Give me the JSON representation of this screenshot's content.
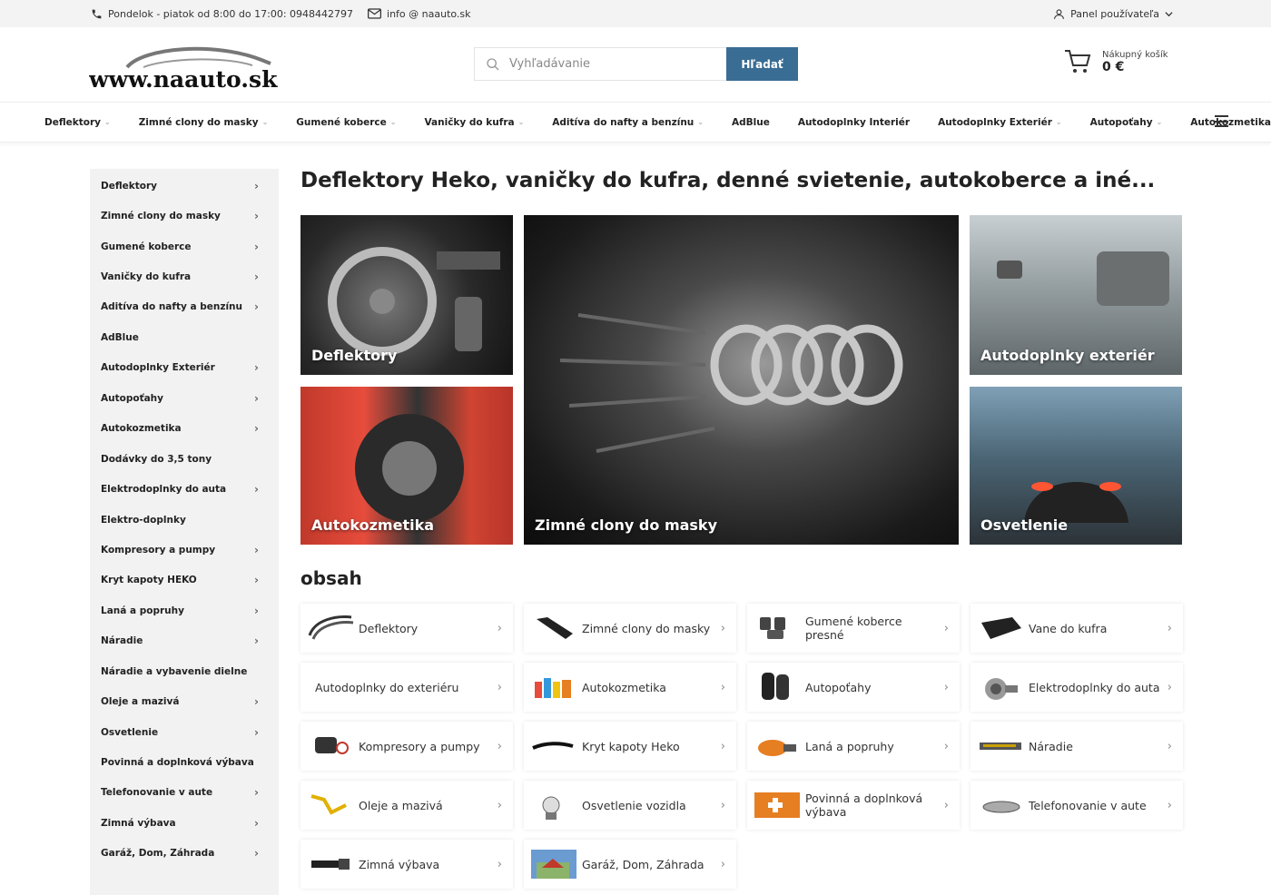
{
  "topbar": {
    "hours": "Pondelok - piatok od 8:00 do 17:00: 0948442797",
    "email": "info @ naauto.sk",
    "user_panel": "Panel používateľa"
  },
  "logo_text": "www.naauto.sk",
  "search": {
    "placeholder": "Vyhľadávanie",
    "button": "Hľadať"
  },
  "cart": {
    "label": "Nákupný košík",
    "total": "0 €"
  },
  "nav": [
    {
      "label": "Deflektory",
      "dropdown": true
    },
    {
      "label": "Zimné clony do masky",
      "dropdown": true
    },
    {
      "label": "Gumené koberce",
      "dropdown": true
    },
    {
      "label": "Vaničky do kufra",
      "dropdown": true
    },
    {
      "label": "Aditíva do nafty a benzínu",
      "dropdown": true
    },
    {
      "label": "AdBlue",
      "dropdown": false
    },
    {
      "label": "Autodoplnky Interiér",
      "dropdown": false
    },
    {
      "label": "Autodoplnky Exteriér",
      "dropdown": true
    },
    {
      "label": "Autopoťahy",
      "dropdown": true
    },
    {
      "label": "Autokozmetika",
      "dropdown": true
    }
  ],
  "sidebar": [
    {
      "label": "Deflektory",
      "arrow": true
    },
    {
      "label": "Zimné clony do masky",
      "arrow": true
    },
    {
      "label": "Gumené koberce",
      "arrow": true
    },
    {
      "label": "Vaničky do kufra",
      "arrow": true
    },
    {
      "label": "Aditíva do nafty a benzínu",
      "arrow": true
    },
    {
      "label": "AdBlue",
      "arrow": false
    },
    {
      "label": "Autodoplnky Exteriér",
      "arrow": true
    },
    {
      "label": "Autopoťahy",
      "arrow": true
    },
    {
      "label": "Autokozmetika",
      "arrow": true
    },
    {
      "label": "Dodávky do 3,5 tony",
      "arrow": false
    },
    {
      "label": "Elektrodoplnky do auta",
      "arrow": true
    },
    {
      "label": "Elektro-doplnky",
      "arrow": false
    },
    {
      "label": "Kompresory a pumpy",
      "arrow": true
    },
    {
      "label": "Kryt kapoty HEKO",
      "arrow": true
    },
    {
      "label": "Laná a popruhy",
      "arrow": true
    },
    {
      "label": "Náradie",
      "arrow": true
    },
    {
      "label": "Náradie a vybavenie dielne",
      "arrow": false
    },
    {
      "label": "Oleje a mazivá",
      "arrow": true
    },
    {
      "label": "Osvetlenie",
      "arrow": true
    },
    {
      "label": "Povinná a doplnková výbava",
      "arrow": false
    },
    {
      "label": "Telefonovanie v aute",
      "arrow": true
    },
    {
      "label": "Zimná výbava",
      "arrow": true
    },
    {
      "label": "Garáž, Dom, Záhrada",
      "arrow": true
    }
  ],
  "main": {
    "title": "Deflektory Heko, vaničky do kufra, denné svietenie, autokoberce a iné...",
    "tiles": [
      "Deflektory",
      "Zimné clony do masky",
      "Autodoplnky exteriér",
      "Autokozmetika",
      "Osvetlenie"
    ],
    "content_heading": "obsah",
    "cards": [
      {
        "label": "Deflektory",
        "icon": "deflector-icon"
      },
      {
        "label": "Zimné clony do masky",
        "icon": "winter-cover-icon"
      },
      {
        "label": "Gumené koberce presné",
        "icon": "rubber-mats-icon"
      },
      {
        "label": "Vane do kufra",
        "icon": "trunk-tray-icon"
      },
      {
        "label": "Autodoplnky do exteriéru",
        "icon": ""
      },
      {
        "label": "Autokozmetika",
        "icon": "cosmetics-icon"
      },
      {
        "label": "Autopoťahy",
        "icon": "seat-covers-icon"
      },
      {
        "label": "Elektrodoplnky do auta",
        "icon": "plug-icon"
      },
      {
        "label": "Kompresory a pumpy",
        "icon": "compressor-icon"
      },
      {
        "label": "Kryt kapoty Heko",
        "icon": "hood-cover-icon"
      },
      {
        "label": "Laná a popruhy",
        "icon": "tow-rope-icon"
      },
      {
        "label": "Náradie",
        "icon": "tool-icon"
      },
      {
        "label": "Oleje a mazivá",
        "icon": "oil-icon"
      },
      {
        "label": "Osvetlenie vozidla",
        "icon": "bulb-icon"
      },
      {
        "label": "Povinná a doplnková výbava",
        "icon": "first-aid-icon"
      },
      {
        "label": "Telefonovanie v aute",
        "icon": "phone-holder-icon"
      },
      {
        "label": "Zimná výbava",
        "icon": "scraper-icon"
      },
      {
        "label": "Garáž, Dom, Záhrada",
        "icon": "house-icon"
      }
    ]
  },
  "colors": {
    "accent": "#3a6d94",
    "sidebar_bg": "#f2f2f2",
    "topbar_bg": "#f3f3f3"
  }
}
